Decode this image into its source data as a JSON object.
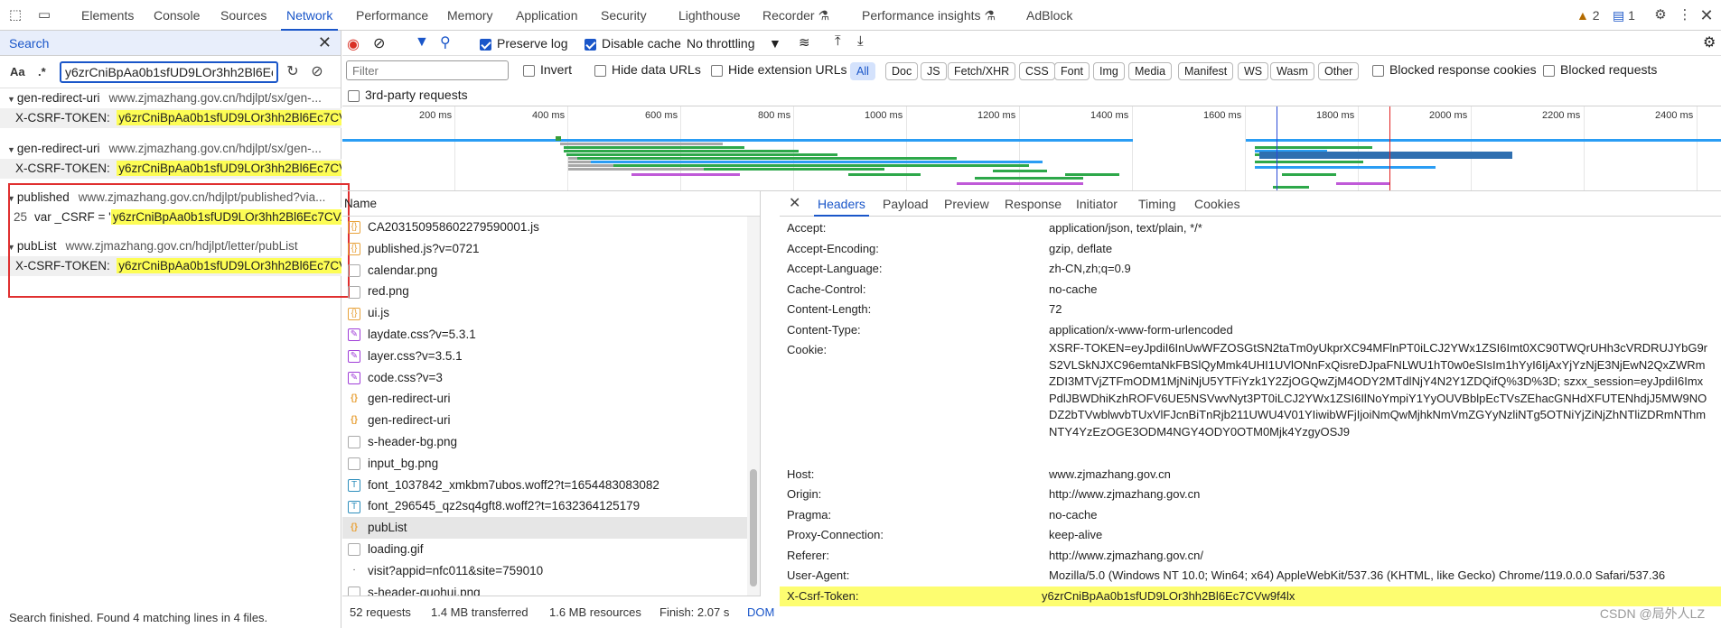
{
  "topbar": {
    "tabs": [
      "Elements",
      "Console",
      "Sources",
      "Network",
      "Performance",
      "Memory",
      "Application",
      "Security",
      "Lighthouse",
      "Recorder",
      "Performance insights",
      "AdBlock"
    ],
    "warnings_count": "2",
    "messages_count": "1"
  },
  "search": {
    "title": "Search",
    "case_label": "Aa",
    "regex_label": ".*",
    "query": "y6zrCniBpAa0b1sfUD9LOr3hh2Bl6Ec7CVw9f4lx",
    "results": [
      {
        "name": "gen-redirect-uri",
        "url": "www.zjmazhang.gov.cn/hdjlpt/sx/gen-...",
        "line_label": "X-CSRF-TOKEN:",
        "line_no": "",
        "match": "y6zrCniBpAa0b1sfUD9LOr3hh2Bl6Ec7CV..."
      },
      {
        "name": "gen-redirect-uri",
        "url": "www.zjmazhang.gov.cn/hdjlpt/sx/gen-...",
        "line_label": "X-CSRF-TOKEN:",
        "line_no": "",
        "match": "y6zrCniBpAa0b1sfUD9LOr3hh2Bl6Ec7CV..."
      },
      {
        "name": "published",
        "url": "www.zjmazhang.gov.cn/hdjlpt/published?via...",
        "line_label": "var _CSRF = '",
        "line_no": "25",
        "match": "y6zrCniBpAa0b1sfUD9LOr3hh2Bl6Ec7CV..."
      },
      {
        "name": "pubList",
        "url": "www.zjmazhang.gov.cn/hdjlpt/letter/pubList",
        "line_label": "X-CSRF-TOKEN:",
        "line_no": "",
        "match": "y6zrCniBpAa0b1sfUD9LOr3hh2Bl6Ec7CV..."
      }
    ],
    "status": "Search finished.  Found 4 matching lines in 4 files."
  },
  "toolbar": {
    "preserve_log": "Preserve log",
    "disable_cache": "Disable cache",
    "throttling": "No throttling"
  },
  "filters": {
    "placeholder": "Filter",
    "invert": "Invert",
    "hide_data_urls": "Hide data URLs",
    "hide_extension_urls": "Hide extension URLs",
    "types": [
      "All",
      "Doc",
      "JS",
      "Fetch/XHR",
      "CSS",
      "Font",
      "Img",
      "Media",
      "Manifest",
      "WS",
      "Wasm",
      "Other"
    ],
    "blocked_cookies": "Blocked response cookies",
    "blocked_requests": "Blocked requests",
    "third_party": "3rd-party requests"
  },
  "timeline": {
    "ticks": [
      "200 ms",
      "400 ms",
      "600 ms",
      "800 ms",
      "1000 ms",
      "1200 ms",
      "1400 ms",
      "1600 ms",
      "1800 ms",
      "2000 ms",
      "2200 ms",
      "2400 ms"
    ]
  },
  "requests": {
    "header": "Name",
    "rows": [
      {
        "name": "CA203150958602279590001.js",
        "type": "js"
      },
      {
        "name": "published.js?v=0721",
        "type": "js"
      },
      {
        "name": "calendar.png",
        "type": "img"
      },
      {
        "name": "red.png",
        "type": "img"
      },
      {
        "name": "ui.js",
        "type": "js"
      },
      {
        "name": "laydate.css?v=5.3.1",
        "type": "css"
      },
      {
        "name": "layer.css?v=3.5.1",
        "type": "css"
      },
      {
        "name": "code.css?v=3",
        "type": "css"
      },
      {
        "name": "gen-redirect-uri",
        "type": "xhr"
      },
      {
        "name": "gen-redirect-uri",
        "type": "xhr"
      },
      {
        "name": "s-header-bg.png",
        "type": "img"
      },
      {
        "name": "input_bg.png",
        "type": "img"
      },
      {
        "name": "font_1037842_xmkbm7ubos.woff2?t=1654483083082",
        "type": "font"
      },
      {
        "name": "font_296545_qz2sq4gft8.woff2?t=1632364125179",
        "type": "font"
      },
      {
        "name": "pubList",
        "type": "xhr"
      },
      {
        "name": "loading.gif",
        "type": "img"
      },
      {
        "name": "visit?appid=nfc011&site=759010",
        "type": "doc"
      },
      {
        "name": "s-header-guohui.png",
        "type": "img"
      }
    ]
  },
  "status": {
    "requests": "52 requests",
    "transferred": "1.4 MB transferred",
    "resources": "1.6 MB resources",
    "finish": "Finish: 2.07 s",
    "dom": "DOM"
  },
  "headers_panel": {
    "tabs": [
      "Headers",
      "Payload",
      "Preview",
      "Response",
      "Initiator",
      "Timing",
      "Cookies"
    ],
    "rows": [
      {
        "name": "Accept:",
        "value": "application/json, text/plain, */*"
      },
      {
        "name": "Accept-Encoding:",
        "value": "gzip, deflate"
      },
      {
        "name": "Accept-Language:",
        "value": "zh-CN,zh;q=0.9"
      },
      {
        "name": "Cache-Control:",
        "value": "no-cache"
      },
      {
        "name": "Content-Length:",
        "value": "72"
      },
      {
        "name": "Content-Type:",
        "value": "application/x-www-form-urlencoded"
      },
      {
        "name": "Cookie:",
        "value": "XSRF-TOKEN=eyJpdiI6InUwWFZOSGtSN2taTm0yUkprXC94MFlnPT0iLCJ2YWx1ZSI6Imt0XC90TWQrUHh3cVRDRUJYbG9rS2VLSkNJXC96emtaNkFBSlQyMmk4UHI1UVlONnFxQisreDJpaFNLWU1hT0w0eSIsIm1hYyI6IjAxYjYzNjE3NjEwN2QxZWRmZDI3MTVjZTFmODM1MjNiNjU5YTFiYzk1Y2ZjOGQwZjM4ODY2MTdlNjY4N2Y1ZDQifQ%3D%3D; szxx_session=eyJpdiI6ImxPdlJBWDhiKzhROFV6UE5NSVwvNyt3PT0iLCJ2YWx1ZSI6IlNoYmpiY1YyOUVBblpEcTVsZEhacGNHdXFUTENhdjJ5MW9NODZ2bTVwblwvbTUxVlFJcnBiTnRjb211UWU4V01YIiwibWFjIjoiNmQwMjhkNmVmZGYyNzliNTg5OTNiYjZiNjZhNTliZDRmNThmNTY4YzEzOGE3ODM4NGY4ODY0OTM0Mjk4YzgyOSJ9"
      },
      {
        "name": "Host:",
        "value": "www.zjmazhang.gov.cn"
      },
      {
        "name": "Origin:",
        "value": "http://www.zjmazhang.gov.cn"
      },
      {
        "name": "Pragma:",
        "value": "no-cache"
      },
      {
        "name": "Proxy-Connection:",
        "value": "keep-alive"
      },
      {
        "name": "Referer:",
        "value": "http://www.zjmazhang.gov.cn/"
      },
      {
        "name": "User-Agent:",
        "value": "Mozilla/5.0 (Windows NT 10.0; Win64; x64) AppleWebKit/537.36 (KHTML, like Gecko) Chrome/119.0.0.0 Safari/537.36"
      },
      {
        "name": "X-Csrf-Token:",
        "value": "y6zrCniBpAa0b1sfUD9LOr3hh2Bl6Ec7CVw9f4lx"
      }
    ]
  },
  "watermark": "CSDN @局外人LZ"
}
